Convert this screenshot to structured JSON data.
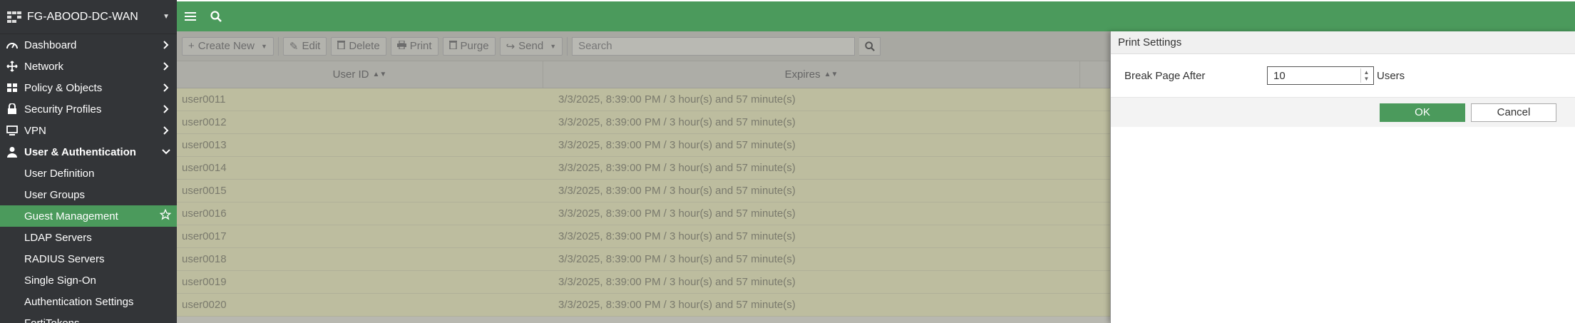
{
  "device": {
    "name": "FG-ABOOD-DC-WAN"
  },
  "sidebar": {
    "items": [
      {
        "label": "Dashboard",
        "icon": "dashboard-icon"
      },
      {
        "label": "Network",
        "icon": "network-icon"
      },
      {
        "label": "Policy & Objects",
        "icon": "policy-icon"
      },
      {
        "label": "Security Profiles",
        "icon": "lock-icon"
      },
      {
        "label": "VPN",
        "icon": "monitor-icon"
      },
      {
        "label": "User & Authentication",
        "icon": "user-icon"
      }
    ],
    "subitems": [
      {
        "label": "User Definition"
      },
      {
        "label": "User Groups"
      },
      {
        "label": "Guest Management"
      },
      {
        "label": "LDAP Servers"
      },
      {
        "label": "RADIUS Servers"
      },
      {
        "label": "Single Sign-On"
      },
      {
        "label": "Authentication Settings"
      },
      {
        "label": "FortiTokens"
      }
    ]
  },
  "toolbar": {
    "create_new": "Create New",
    "edit": "Edit",
    "delete": "Delete",
    "print": "Print",
    "purge": "Purge",
    "send": "Send",
    "search_placeholder": "Search"
  },
  "table": {
    "headers": [
      "User ID",
      "Expires"
    ],
    "rows": [
      {
        "user": "user0011",
        "expires": "3/3/2025, 8:39:00 PM / 3 hour(s) and 57 minute(s)"
      },
      {
        "user": "user0012",
        "expires": "3/3/2025, 8:39:00 PM / 3 hour(s) and 57 minute(s)"
      },
      {
        "user": "user0013",
        "expires": "3/3/2025, 8:39:00 PM / 3 hour(s) and 57 minute(s)"
      },
      {
        "user": "user0014",
        "expires": "3/3/2025, 8:39:00 PM / 3 hour(s) and 57 minute(s)"
      },
      {
        "user": "user0015",
        "expires": "3/3/2025, 8:39:00 PM / 3 hour(s) and 57 minute(s)"
      },
      {
        "user": "user0016",
        "expires": "3/3/2025, 8:39:00 PM / 3 hour(s) and 57 minute(s)"
      },
      {
        "user": "user0017",
        "expires": "3/3/2025, 8:39:00 PM / 3 hour(s) and 57 minute(s)"
      },
      {
        "user": "user0018",
        "expires": "3/3/2025, 8:39:00 PM / 3 hour(s) and 57 minute(s)"
      },
      {
        "user": "user0019",
        "expires": "3/3/2025, 8:39:00 PM / 3 hour(s) and 57 minute(s)"
      },
      {
        "user": "user0020",
        "expires": "3/3/2025, 8:39:00 PM / 3 hour(s) and 57 minute(s)"
      }
    ]
  },
  "print_settings": {
    "title": "Print Settings",
    "field_label": "Break Page After",
    "value": "10",
    "unit": "Users",
    "ok": "OK",
    "cancel": "Cancel"
  },
  "colors": {
    "accent": "#4b9a5c",
    "sidebar": "#333538"
  }
}
